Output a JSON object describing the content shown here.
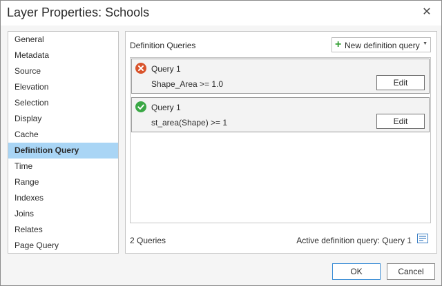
{
  "window": {
    "title": "Layer Properties: Schools",
    "close_glyph": "✕"
  },
  "nav": {
    "items": [
      {
        "label": "General",
        "active": false
      },
      {
        "label": "Metadata",
        "active": false
      },
      {
        "label": "Source",
        "active": false
      },
      {
        "label": "Elevation",
        "active": false
      },
      {
        "label": "Selection",
        "active": false
      },
      {
        "label": "Display",
        "active": false
      },
      {
        "label": "Cache",
        "active": false
      },
      {
        "label": "Definition Query",
        "active": true
      },
      {
        "label": "Time",
        "active": false
      },
      {
        "label": "Range",
        "active": false
      },
      {
        "label": "Indexes",
        "active": false
      },
      {
        "label": "Joins",
        "active": false
      },
      {
        "label": "Relates",
        "active": false
      },
      {
        "label": "Page Query",
        "active": false
      }
    ]
  },
  "panel": {
    "title": "Definition Queries",
    "new_query_label": "New definition query",
    "queries": [
      {
        "name": "Query 1",
        "expression": "Shape_Area >= 1.0",
        "status": "invalid",
        "status_icon": "error-icon",
        "edit_label": "Edit"
      },
      {
        "name": "Query 1",
        "expression": "st_area(Shape) >= 1",
        "status": "valid",
        "status_icon": "checkmark-icon",
        "edit_label": "Edit"
      }
    ],
    "count_label": "2 Queries",
    "active_label": "Active definition query: Query 1"
  },
  "footer": {
    "ok_label": "OK",
    "cancel_label": "Cancel"
  },
  "colors": {
    "nav_active": "#a9d5f5",
    "error": "#d9542c",
    "success": "#3aa845",
    "accent_border": "#3b8ed6"
  }
}
